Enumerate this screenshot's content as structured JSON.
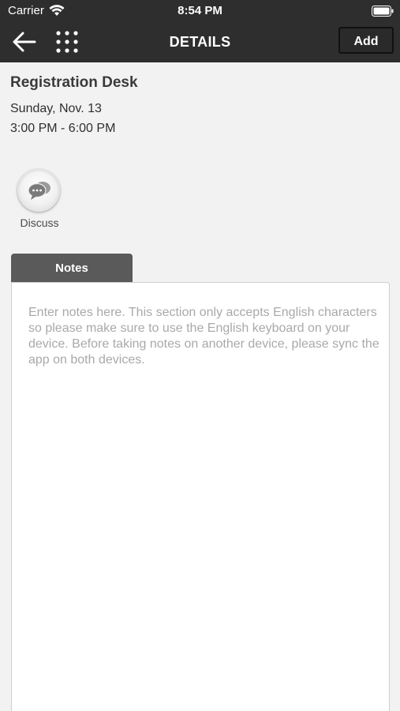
{
  "status_bar": {
    "carrier": "Carrier",
    "time": "8:54 PM",
    "icons": [
      "wifi-icon",
      "battery-icon"
    ]
  },
  "nav": {
    "title": "DETAILS",
    "add_label": "Add",
    "icons": [
      "back-arrow-icon",
      "grid-menu-icon"
    ]
  },
  "event": {
    "title": "Registration Desk",
    "date": "Sunday, Nov. 13",
    "time": "3:00 PM - 6:00 PM"
  },
  "discuss": {
    "label": "Discuss",
    "icon": "chat-bubbles-icon"
  },
  "notes": {
    "tab_label": "Notes",
    "placeholder": "Enter notes here. This section only accepts English characters so please make sure to use the English keyboard on your device. Before taking notes on another device, please sync the app on both devices."
  },
  "colors": {
    "header_bg": "#2e2e2e",
    "page_bg": "#f2f2f2",
    "tab_bg": "#5a5a5a",
    "placeholder_text": "#a9a9a9"
  }
}
